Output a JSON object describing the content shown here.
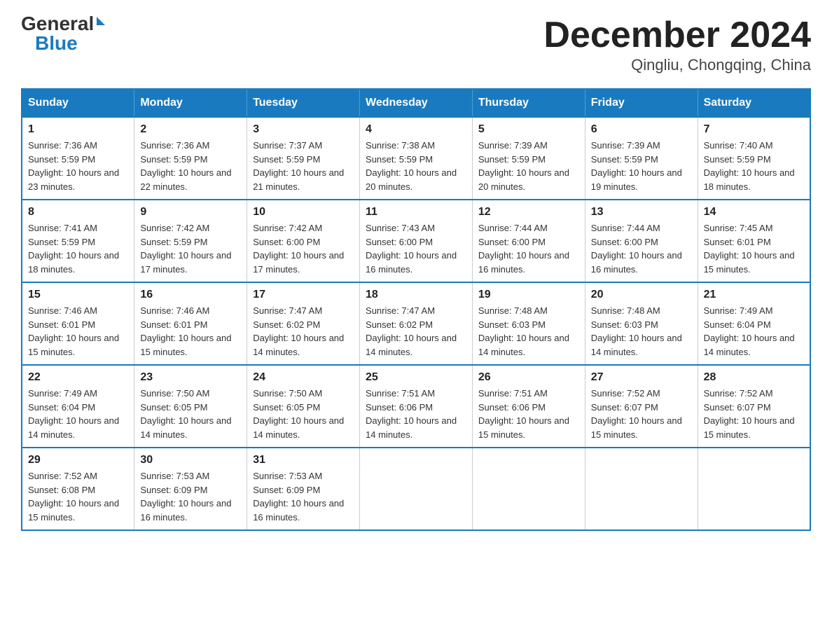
{
  "logo": {
    "general": "General",
    "blue": "Blue"
  },
  "title": "December 2024",
  "subtitle": "Qingliu, Chongqing, China",
  "weekdays": [
    "Sunday",
    "Monday",
    "Tuesday",
    "Wednesday",
    "Thursday",
    "Friday",
    "Saturday"
  ],
  "weeks": [
    [
      {
        "day": "1",
        "sunrise": "7:36 AM",
        "sunset": "5:59 PM",
        "daylight": "10 hours and 23 minutes."
      },
      {
        "day": "2",
        "sunrise": "7:36 AM",
        "sunset": "5:59 PM",
        "daylight": "10 hours and 22 minutes."
      },
      {
        "day": "3",
        "sunrise": "7:37 AM",
        "sunset": "5:59 PM",
        "daylight": "10 hours and 21 minutes."
      },
      {
        "day": "4",
        "sunrise": "7:38 AM",
        "sunset": "5:59 PM",
        "daylight": "10 hours and 20 minutes."
      },
      {
        "day": "5",
        "sunrise": "7:39 AM",
        "sunset": "5:59 PM",
        "daylight": "10 hours and 20 minutes."
      },
      {
        "day": "6",
        "sunrise": "7:39 AM",
        "sunset": "5:59 PM",
        "daylight": "10 hours and 19 minutes."
      },
      {
        "day": "7",
        "sunrise": "7:40 AM",
        "sunset": "5:59 PM",
        "daylight": "10 hours and 18 minutes."
      }
    ],
    [
      {
        "day": "8",
        "sunrise": "7:41 AM",
        "sunset": "5:59 PM",
        "daylight": "10 hours and 18 minutes."
      },
      {
        "day": "9",
        "sunrise": "7:42 AM",
        "sunset": "5:59 PM",
        "daylight": "10 hours and 17 minutes."
      },
      {
        "day": "10",
        "sunrise": "7:42 AM",
        "sunset": "6:00 PM",
        "daylight": "10 hours and 17 minutes."
      },
      {
        "day": "11",
        "sunrise": "7:43 AM",
        "sunset": "6:00 PM",
        "daylight": "10 hours and 16 minutes."
      },
      {
        "day": "12",
        "sunrise": "7:44 AM",
        "sunset": "6:00 PM",
        "daylight": "10 hours and 16 minutes."
      },
      {
        "day": "13",
        "sunrise": "7:44 AM",
        "sunset": "6:00 PM",
        "daylight": "10 hours and 16 minutes."
      },
      {
        "day": "14",
        "sunrise": "7:45 AM",
        "sunset": "6:01 PM",
        "daylight": "10 hours and 15 minutes."
      }
    ],
    [
      {
        "day": "15",
        "sunrise": "7:46 AM",
        "sunset": "6:01 PM",
        "daylight": "10 hours and 15 minutes."
      },
      {
        "day": "16",
        "sunrise": "7:46 AM",
        "sunset": "6:01 PM",
        "daylight": "10 hours and 15 minutes."
      },
      {
        "day": "17",
        "sunrise": "7:47 AM",
        "sunset": "6:02 PM",
        "daylight": "10 hours and 14 minutes."
      },
      {
        "day": "18",
        "sunrise": "7:47 AM",
        "sunset": "6:02 PM",
        "daylight": "10 hours and 14 minutes."
      },
      {
        "day": "19",
        "sunrise": "7:48 AM",
        "sunset": "6:03 PM",
        "daylight": "10 hours and 14 minutes."
      },
      {
        "day": "20",
        "sunrise": "7:48 AM",
        "sunset": "6:03 PM",
        "daylight": "10 hours and 14 minutes."
      },
      {
        "day": "21",
        "sunrise": "7:49 AM",
        "sunset": "6:04 PM",
        "daylight": "10 hours and 14 minutes."
      }
    ],
    [
      {
        "day": "22",
        "sunrise": "7:49 AM",
        "sunset": "6:04 PM",
        "daylight": "10 hours and 14 minutes."
      },
      {
        "day": "23",
        "sunrise": "7:50 AM",
        "sunset": "6:05 PM",
        "daylight": "10 hours and 14 minutes."
      },
      {
        "day": "24",
        "sunrise": "7:50 AM",
        "sunset": "6:05 PM",
        "daylight": "10 hours and 14 minutes."
      },
      {
        "day": "25",
        "sunrise": "7:51 AM",
        "sunset": "6:06 PM",
        "daylight": "10 hours and 14 minutes."
      },
      {
        "day": "26",
        "sunrise": "7:51 AM",
        "sunset": "6:06 PM",
        "daylight": "10 hours and 15 minutes."
      },
      {
        "day": "27",
        "sunrise": "7:52 AM",
        "sunset": "6:07 PM",
        "daylight": "10 hours and 15 minutes."
      },
      {
        "day": "28",
        "sunrise": "7:52 AM",
        "sunset": "6:07 PM",
        "daylight": "10 hours and 15 minutes."
      }
    ],
    [
      {
        "day": "29",
        "sunrise": "7:52 AM",
        "sunset": "6:08 PM",
        "daylight": "10 hours and 15 minutes."
      },
      {
        "day": "30",
        "sunrise": "7:53 AM",
        "sunset": "6:09 PM",
        "daylight": "10 hours and 16 minutes."
      },
      {
        "day": "31",
        "sunrise": "7:53 AM",
        "sunset": "6:09 PM",
        "daylight": "10 hours and 16 minutes."
      },
      null,
      null,
      null,
      null
    ]
  ]
}
